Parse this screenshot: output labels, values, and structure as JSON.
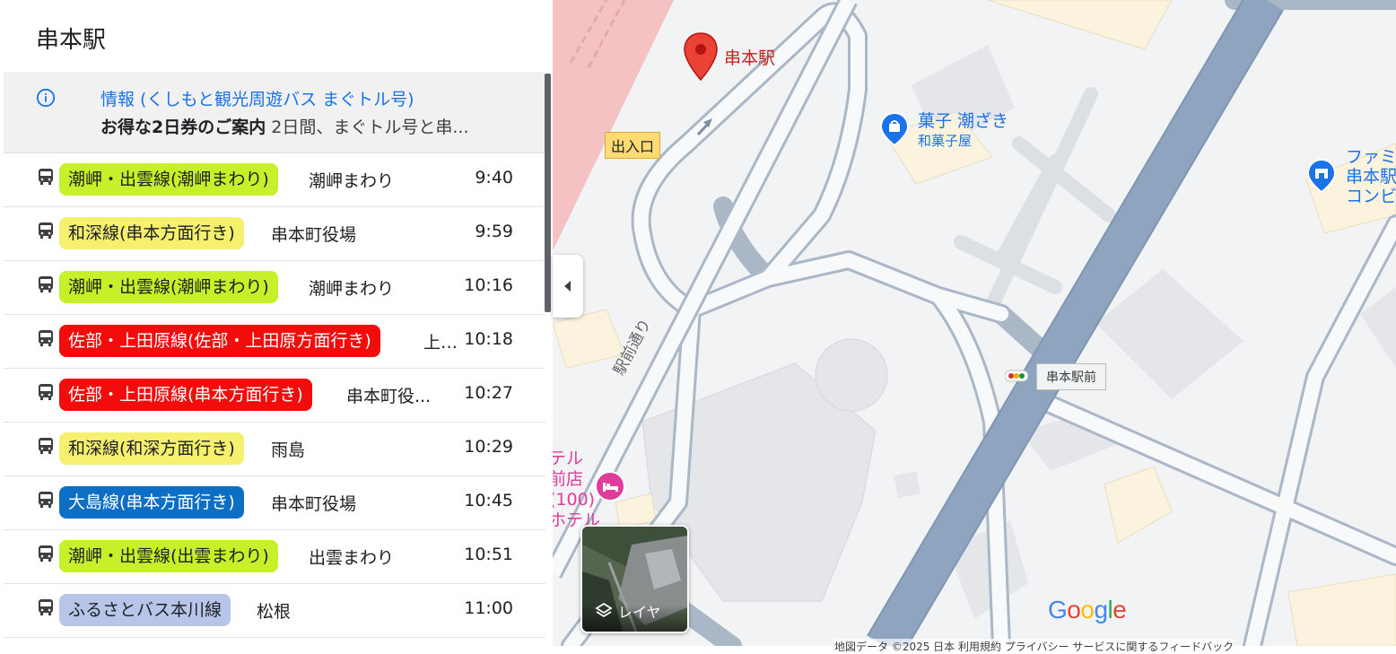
{
  "panel": {
    "title": "串本駅",
    "info": {
      "title": "情報 (くしもと観光周遊バス まぐトル号)",
      "text_bold": "お得な2日券のご案内",
      "text_rest": " 2日間、まぐトル号と串..."
    }
  },
  "departures": [
    {
      "route": "潮岬・出雲線(潮岬まわり)",
      "dest": "潮岬まわり",
      "time": "9:40",
      "chip_bg": "#c6f02a",
      "chip_fg": "#202124"
    },
    {
      "route": "和深線(串本方面行き)",
      "dest": "串本町役場",
      "time": "9:59",
      "chip_bg": "#f5f06e",
      "chip_fg": "#202124"
    },
    {
      "route": "潮岬・出雲線(潮岬まわり)",
      "dest": "潮岬まわり",
      "time": "10:16",
      "chip_bg": "#c6f02a",
      "chip_fg": "#202124"
    },
    {
      "route": "佐部・上田原線(佐部・上田原方面行き)",
      "dest": "上...",
      "time": "10:18",
      "chip_bg": "#f20c0c",
      "chip_fg": "#ffffff"
    },
    {
      "route": "佐部・上田原線(串本方面行き)",
      "dest": "串本町役...",
      "time": "10:27",
      "chip_bg": "#f20c0c",
      "chip_fg": "#ffffff"
    },
    {
      "route": "和深線(和深方面行き)",
      "dest": "雨島",
      "time": "10:29",
      "chip_bg": "#f5f06e",
      "chip_fg": "#202124"
    },
    {
      "route": "大島線(串本方面行き)",
      "dest": "串本町役場",
      "time": "10:45",
      "chip_bg": "#0d6fc3",
      "chip_fg": "#ffffff"
    },
    {
      "route": "潮岬・出雲線(出雲まわり)",
      "dest": "出雲まわり",
      "time": "10:51",
      "chip_bg": "#c6f02a",
      "chip_fg": "#202124"
    },
    {
      "route": "ふるさとバス本川線",
      "dest": "松根",
      "time": "11:00",
      "chip_bg": "#b7c6e8",
      "chip_fg": "#202124"
    }
  ],
  "map": {
    "station_label": "串本駅",
    "entrance_label": "出入口",
    "shop_name": "菓子 潮ざき",
    "shop_type": "和菓子屋",
    "store_name_1": "ファミ",
    "store_name_2": "串本駅",
    "store_name_3": "コンビ",
    "road_label": "駅前通り",
    "bus_stop_label": "串本駅前",
    "hotel_1": "テル",
    "hotel_2": "前店",
    "hotel_3": "(100)",
    "hotel_4": "ホテル",
    "layer_label": "レイヤ",
    "google": "Google",
    "footer": "地図データ ©2025    日本    利用規約    プライバシー    サービスに関するフィードバック"
  },
  "colors": {
    "accent": "#1a73e8",
    "pin": "#ea4335",
    "station_area": "#f4c2c2",
    "road": "#aab7c7",
    "main_road": "#8fa5bf",
    "building": "#e4e6ea",
    "poi_blue": "#1a73e8",
    "hotel_pink": "#e03c9b"
  }
}
